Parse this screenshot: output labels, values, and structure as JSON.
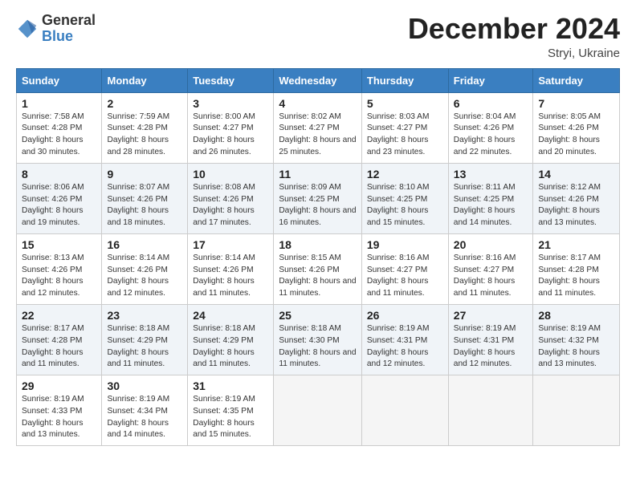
{
  "header": {
    "logo_general": "General",
    "logo_blue": "Blue",
    "title": "December 2024",
    "subtitle": "Stryi, Ukraine"
  },
  "calendar": {
    "headers": [
      "Sunday",
      "Monday",
      "Tuesday",
      "Wednesday",
      "Thursday",
      "Friday",
      "Saturday"
    ],
    "weeks": [
      [
        {
          "day": "1",
          "sunrise": "Sunrise: 7:58 AM",
          "sunset": "Sunset: 4:28 PM",
          "daylight": "Daylight: 8 hours and 30 minutes."
        },
        {
          "day": "2",
          "sunrise": "Sunrise: 7:59 AM",
          "sunset": "Sunset: 4:28 PM",
          "daylight": "Daylight: 8 hours and 28 minutes."
        },
        {
          "day": "3",
          "sunrise": "Sunrise: 8:00 AM",
          "sunset": "Sunset: 4:27 PM",
          "daylight": "Daylight: 8 hours and 26 minutes."
        },
        {
          "day": "4",
          "sunrise": "Sunrise: 8:02 AM",
          "sunset": "Sunset: 4:27 PM",
          "daylight": "Daylight: 8 hours and 25 minutes."
        },
        {
          "day": "5",
          "sunrise": "Sunrise: 8:03 AM",
          "sunset": "Sunset: 4:27 PM",
          "daylight": "Daylight: 8 hours and 23 minutes."
        },
        {
          "day": "6",
          "sunrise": "Sunrise: 8:04 AM",
          "sunset": "Sunset: 4:26 PM",
          "daylight": "Daylight: 8 hours and 22 minutes."
        },
        {
          "day": "7",
          "sunrise": "Sunrise: 8:05 AM",
          "sunset": "Sunset: 4:26 PM",
          "daylight": "Daylight: 8 hours and 20 minutes."
        }
      ],
      [
        {
          "day": "8",
          "sunrise": "Sunrise: 8:06 AM",
          "sunset": "Sunset: 4:26 PM",
          "daylight": "Daylight: 8 hours and 19 minutes."
        },
        {
          "day": "9",
          "sunrise": "Sunrise: 8:07 AM",
          "sunset": "Sunset: 4:26 PM",
          "daylight": "Daylight: 8 hours and 18 minutes."
        },
        {
          "day": "10",
          "sunrise": "Sunrise: 8:08 AM",
          "sunset": "Sunset: 4:26 PM",
          "daylight": "Daylight: 8 hours and 17 minutes."
        },
        {
          "day": "11",
          "sunrise": "Sunrise: 8:09 AM",
          "sunset": "Sunset: 4:25 PM",
          "daylight": "Daylight: 8 hours and 16 minutes."
        },
        {
          "day": "12",
          "sunrise": "Sunrise: 8:10 AM",
          "sunset": "Sunset: 4:25 PM",
          "daylight": "Daylight: 8 hours and 15 minutes."
        },
        {
          "day": "13",
          "sunrise": "Sunrise: 8:11 AM",
          "sunset": "Sunset: 4:25 PM",
          "daylight": "Daylight: 8 hours and 14 minutes."
        },
        {
          "day": "14",
          "sunrise": "Sunrise: 8:12 AM",
          "sunset": "Sunset: 4:26 PM",
          "daylight": "Daylight: 8 hours and 13 minutes."
        }
      ],
      [
        {
          "day": "15",
          "sunrise": "Sunrise: 8:13 AM",
          "sunset": "Sunset: 4:26 PM",
          "daylight": "Daylight: 8 hours and 12 minutes."
        },
        {
          "day": "16",
          "sunrise": "Sunrise: 8:14 AM",
          "sunset": "Sunset: 4:26 PM",
          "daylight": "Daylight: 8 hours and 12 minutes."
        },
        {
          "day": "17",
          "sunrise": "Sunrise: 8:14 AM",
          "sunset": "Sunset: 4:26 PM",
          "daylight": "Daylight: 8 hours and 11 minutes."
        },
        {
          "day": "18",
          "sunrise": "Sunrise: 8:15 AM",
          "sunset": "Sunset: 4:26 PM",
          "daylight": "Daylight: 8 hours and 11 minutes."
        },
        {
          "day": "19",
          "sunrise": "Sunrise: 8:16 AM",
          "sunset": "Sunset: 4:27 PM",
          "daylight": "Daylight: 8 hours and 11 minutes."
        },
        {
          "day": "20",
          "sunrise": "Sunrise: 8:16 AM",
          "sunset": "Sunset: 4:27 PM",
          "daylight": "Daylight: 8 hours and 11 minutes."
        },
        {
          "day": "21",
          "sunrise": "Sunrise: 8:17 AM",
          "sunset": "Sunset: 4:28 PM",
          "daylight": "Daylight: 8 hours and 11 minutes."
        }
      ],
      [
        {
          "day": "22",
          "sunrise": "Sunrise: 8:17 AM",
          "sunset": "Sunset: 4:28 PM",
          "daylight": "Daylight: 8 hours and 11 minutes."
        },
        {
          "day": "23",
          "sunrise": "Sunrise: 8:18 AM",
          "sunset": "Sunset: 4:29 PM",
          "daylight": "Daylight: 8 hours and 11 minutes."
        },
        {
          "day": "24",
          "sunrise": "Sunrise: 8:18 AM",
          "sunset": "Sunset: 4:29 PM",
          "daylight": "Daylight: 8 hours and 11 minutes."
        },
        {
          "day": "25",
          "sunrise": "Sunrise: 8:18 AM",
          "sunset": "Sunset: 4:30 PM",
          "daylight": "Daylight: 8 hours and 11 minutes."
        },
        {
          "day": "26",
          "sunrise": "Sunrise: 8:19 AM",
          "sunset": "Sunset: 4:31 PM",
          "daylight": "Daylight: 8 hours and 12 minutes."
        },
        {
          "day": "27",
          "sunrise": "Sunrise: 8:19 AM",
          "sunset": "Sunset: 4:31 PM",
          "daylight": "Daylight: 8 hours and 12 minutes."
        },
        {
          "day": "28",
          "sunrise": "Sunrise: 8:19 AM",
          "sunset": "Sunset: 4:32 PM",
          "daylight": "Daylight: 8 hours and 13 minutes."
        }
      ],
      [
        {
          "day": "29",
          "sunrise": "Sunrise: 8:19 AM",
          "sunset": "Sunset: 4:33 PM",
          "daylight": "Daylight: 8 hours and 13 minutes."
        },
        {
          "day": "30",
          "sunrise": "Sunrise: 8:19 AM",
          "sunset": "Sunset: 4:34 PM",
          "daylight": "Daylight: 8 hours and 14 minutes."
        },
        {
          "day": "31",
          "sunrise": "Sunrise: 8:19 AM",
          "sunset": "Sunset: 4:35 PM",
          "daylight": "Daylight: 8 hours and 15 minutes."
        },
        null,
        null,
        null,
        null
      ]
    ]
  }
}
